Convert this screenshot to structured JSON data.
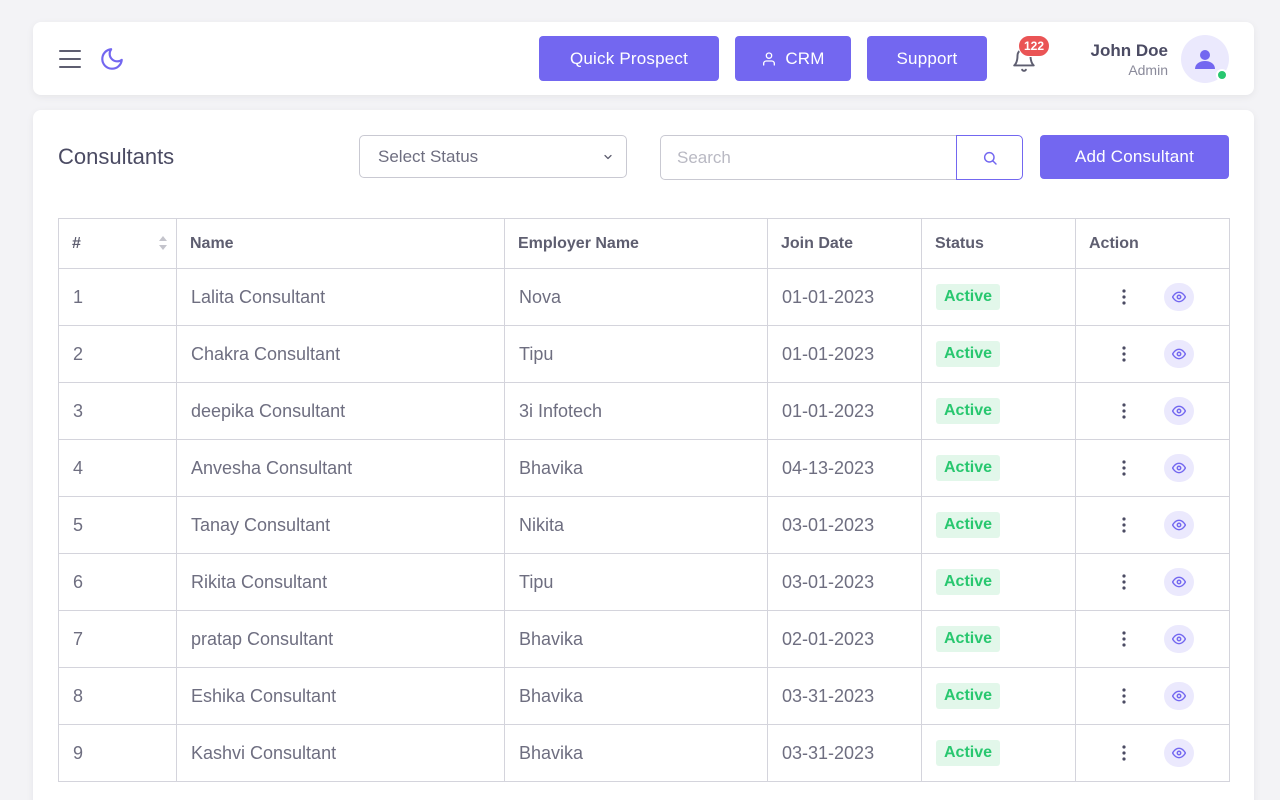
{
  "header": {
    "quick_prospect_label": "Quick Prospect",
    "crm_label": "CRM",
    "support_label": "Support",
    "notification_count": "122",
    "user_name": "John Doe",
    "user_role": "Admin"
  },
  "page": {
    "title": "Consultants",
    "status_select_value": "Select Status",
    "search_placeholder": "Search",
    "add_button_label": "Add Consultant"
  },
  "table": {
    "columns": [
      "#",
      "Name",
      "Employer Name",
      "Join Date",
      "Status",
      "Action"
    ],
    "rows": [
      {
        "num": "1",
        "name": "Lalita Consultant",
        "employer": "Nova",
        "join_date": "01-01-2023",
        "status": "Active"
      },
      {
        "num": "2",
        "name": "Chakra Consultant",
        "employer": "Tipu",
        "join_date": "01-01-2023",
        "status": "Active"
      },
      {
        "num": "3",
        "name": "deepika Consultant",
        "employer": "3i Infotech",
        "join_date": "01-01-2023",
        "status": "Active"
      },
      {
        "num": "4",
        "name": "Anvesha Consultant",
        "employer": "Bhavika",
        "join_date": "04-13-2023",
        "status": "Active"
      },
      {
        "num": "5",
        "name": "Tanay Consultant",
        "employer": "Nikita",
        "join_date": "03-01-2023",
        "status": "Active"
      },
      {
        "num": "6",
        "name": "Rikita Consultant",
        "employer": "Tipu",
        "join_date": "03-01-2023",
        "status": "Active"
      },
      {
        "num": "7",
        "name": "pratap Consultant",
        "employer": "Bhavika",
        "join_date": "02-01-2023",
        "status": "Active"
      },
      {
        "num": "8",
        "name": "Eshika Consultant",
        "employer": "Bhavika",
        "join_date": "03-31-2023",
        "status": "Active"
      },
      {
        "num": "9",
        "name": "Kashvi Consultant",
        "employer": "Bhavika",
        "join_date": "03-31-2023",
        "status": "Active"
      }
    ]
  },
  "colors": {
    "primary": "#7367f0",
    "success": "#28c76f",
    "success_bg": "#e2f7ea",
    "danger": "#ea5455",
    "background": "#f3f3f6"
  },
  "icons": [
    "menu-icon",
    "moon-icon",
    "user-icon",
    "bell-icon",
    "avatar-icon",
    "chevron-down-icon",
    "search-icon",
    "sort-icon",
    "more-vertical-icon",
    "eye-icon"
  ]
}
